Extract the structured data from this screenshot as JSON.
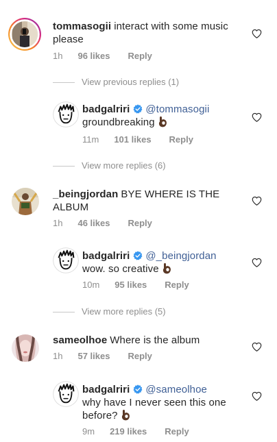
{
  "comments": [
    {
      "username": "tommasogii",
      "text": "interact with some music please",
      "time": "1h",
      "likes": "96 likes",
      "reply": "Reply",
      "avatar_icon": "photo-avatar-icon"
    },
    {
      "username": "badgalriri",
      "verified": true,
      "mention": "@tommasogii",
      "text": "groundbreaking",
      "emoji": "ok-hand-emoji",
      "time": "11m",
      "likes": "101 likes",
      "reply": "Reply"
    },
    {
      "username": "_beingjordan",
      "text": "BYE WHERE IS THE ALBUM",
      "time": "1h",
      "likes": "46 likes",
      "reply": "Reply"
    },
    {
      "username": "badgalriri",
      "verified": true,
      "mention": "@_beingjordan",
      "text": "wow. so creative",
      "emoji": "ok-hand-emoji",
      "time": "10m",
      "likes": "95 likes",
      "reply": "Reply"
    },
    {
      "username": "sameolhoe",
      "text": "Where is the album",
      "time": "1h",
      "likes": "57 likes",
      "reply": "Reply"
    },
    {
      "username": "badgalriri",
      "verified": true,
      "mention": "@sameolhoe",
      "text": "why have I never seen this one before?",
      "emoji": "ok-hand-emoji",
      "time": "9m",
      "likes": "219 likes",
      "reply": "Reply"
    }
  ],
  "view_previous_replies": "View previous replies (1)",
  "view_more_replies_1": "View more replies (6)",
  "view_more_replies_2": "View more replies (5)",
  "colors": {
    "text": "#262626",
    "secondary": "#8e8e8e",
    "mention": "#3f5f95",
    "verified": "#3897f0",
    "story_ring": [
      "#f58529",
      "#dd2a7b",
      "#8134af"
    ]
  }
}
